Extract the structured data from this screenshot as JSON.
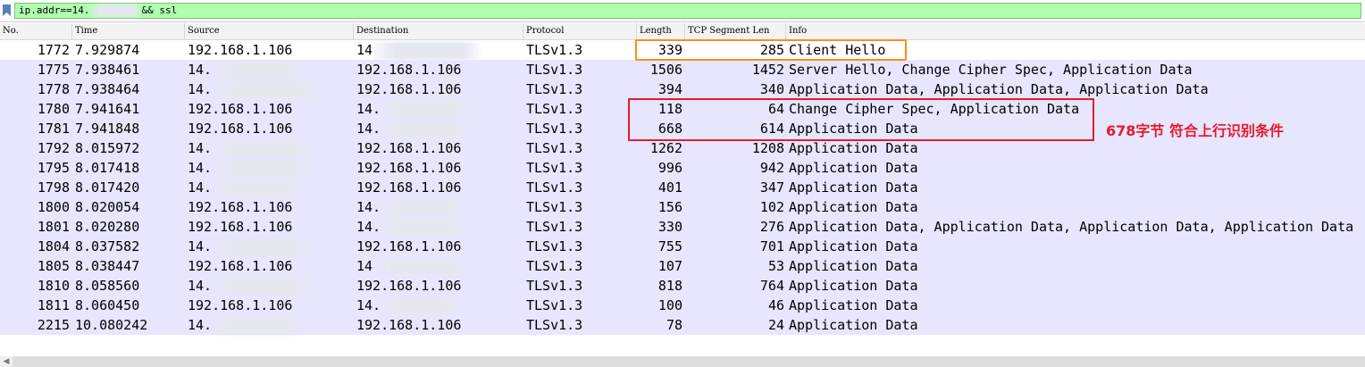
{
  "filter": {
    "text_prefix": "ip.addr==14.",
    "text_suffix": "&& ssl",
    "field_color": "#afffaf"
  },
  "columns": {
    "no": "No.",
    "time": "Time",
    "source": "Source",
    "destination": "Destination",
    "protocol": "Protocol",
    "length": "Length",
    "seg": "TCP Segment Len",
    "info": "Info"
  },
  "packets": [
    {
      "no": "1772",
      "time": "7.929874",
      "source": "192.168.1.106",
      "destination": "14",
      "protocol": "TLSv1.3",
      "length": "339",
      "seg": "285",
      "info": "Client Hello"
    },
    {
      "no": "1775",
      "time": "7.938461",
      "source": "14.",
      "destination": "192.168.1.106",
      "protocol": "TLSv1.3",
      "length": "1506",
      "seg": "1452",
      "info": "Server Hello, Change Cipher Spec, Application Data"
    },
    {
      "no": "1778",
      "time": "7.938464",
      "source": "14.",
      "destination": "192.168.1.106",
      "protocol": "TLSv1.3",
      "length": "394",
      "seg": "340",
      "info": "Application Data, Application Data, Application Data"
    },
    {
      "no": "1780",
      "time": "7.941641",
      "source": "192.168.1.106",
      "destination": "14.",
      "protocol": "TLSv1.3",
      "length": "118",
      "seg": "64",
      "info": "Change Cipher Spec, Application Data"
    },
    {
      "no": "1781",
      "time": "7.941848",
      "source": "192.168.1.106",
      "destination": "14.",
      "protocol": "TLSv1.3",
      "length": "668",
      "seg": "614",
      "info": "Application Data"
    },
    {
      "no": "1792",
      "time": "8.015972",
      "source": "14.",
      "destination": "192.168.1.106",
      "protocol": "TLSv1.3",
      "length": "1262",
      "seg": "1208",
      "info": "Application Data"
    },
    {
      "no": "1795",
      "time": "8.017418",
      "source": "14.",
      "destination": "192.168.1.106",
      "protocol": "TLSv1.3",
      "length": "996",
      "seg": "942",
      "info": "Application Data"
    },
    {
      "no": "1798",
      "time": "8.017420",
      "source": "14.",
      "destination": "192.168.1.106",
      "protocol": "TLSv1.3",
      "length": "401",
      "seg": "347",
      "info": "Application Data"
    },
    {
      "no": "1800",
      "time": "8.020054",
      "source": "192.168.1.106",
      "destination": "14.",
      "protocol": "TLSv1.3",
      "length": "156",
      "seg": "102",
      "info": "Application Data"
    },
    {
      "no": "1801",
      "time": "8.020280",
      "source": "192.168.1.106",
      "destination": "14.",
      "protocol": "TLSv1.3",
      "length": "330",
      "seg": "276",
      "info": "Application Data, Application Data, Application Data, Application Data"
    },
    {
      "no": "1804",
      "time": "8.037582",
      "source": "14.",
      "destination": "192.168.1.106",
      "protocol": "TLSv1.3",
      "length": "755",
      "seg": "701",
      "info": "Application Data"
    },
    {
      "no": "1805",
      "time": "8.038447",
      "source": "192.168.1.106",
      "destination": "14",
      "protocol": "TLSv1.3",
      "length": "107",
      "seg": "53",
      "info": "Application Data"
    },
    {
      "no": "1810",
      "time": "8.058560",
      "source": "14.",
      "destination": "192.168.1.106",
      "protocol": "TLSv1.3",
      "length": "818",
      "seg": "764",
      "info": "Application Data"
    },
    {
      "no": "1811",
      "time": "8.060450",
      "source": "192.168.1.106",
      "destination": "14.",
      "protocol": "TLSv1.3",
      "length": "100",
      "seg": "46",
      "info": "Application Data"
    },
    {
      "no": "2215",
      "time": "10.080242",
      "source": "14.",
      "destination": "192.168.1.106",
      "protocol": "TLSv1.3",
      "length": "78",
      "seg": "24",
      "info": "Application Data"
    }
  ],
  "annotation": {
    "text": "678字节 符合上行识别条件",
    "color": "#e8192c"
  },
  "highlight_colors": {
    "orange_box": "#ff8c1a",
    "red_box": "#e8192c",
    "row_background": "#e7e6ff"
  }
}
